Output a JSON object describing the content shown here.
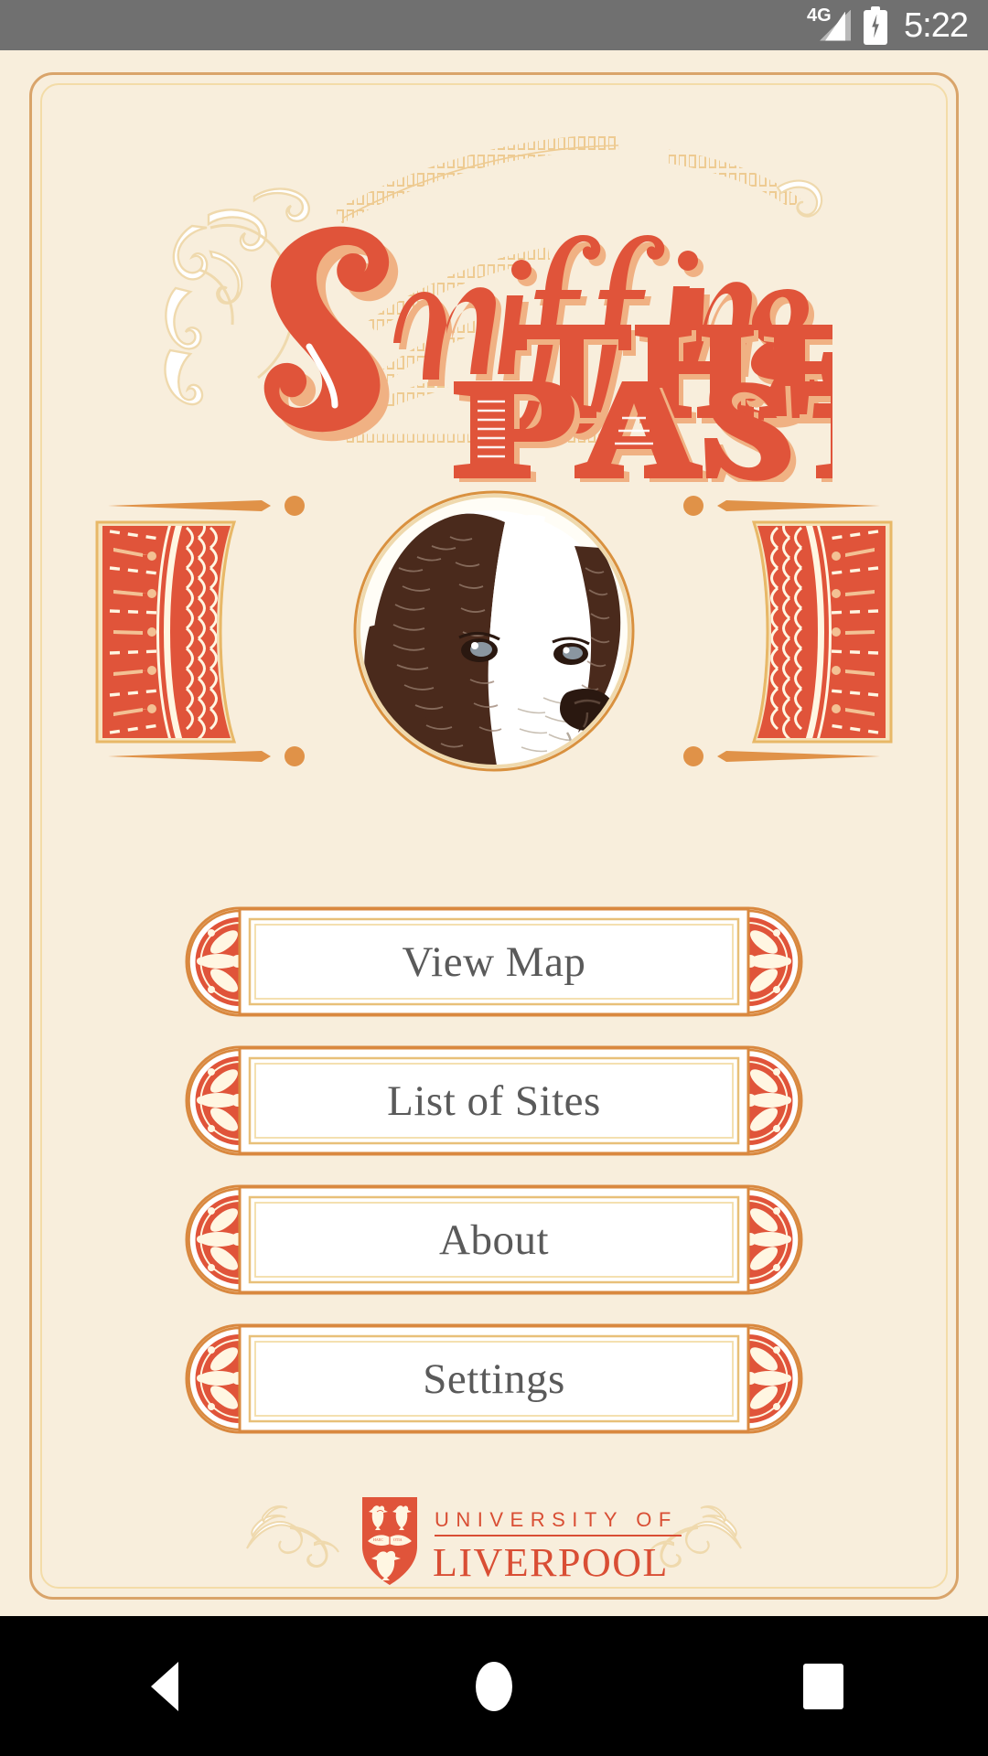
{
  "status_bar": {
    "network_label": "4G",
    "network_icon": "signal-bars-icon",
    "battery_icon": "battery-charging-icon",
    "time": "5:22"
  },
  "app": {
    "title_line1": "Sniffing",
    "title_line2": "THE",
    "title_line3": "PAST",
    "hero_icon": "dog-portrait-illustration"
  },
  "menu": {
    "items": [
      {
        "label": "View Map",
        "name": "view-map"
      },
      {
        "label": "List of Sites",
        "name": "list-of-sites"
      },
      {
        "label": "About",
        "name": "about"
      },
      {
        "label": "Settings",
        "name": "settings"
      }
    ]
  },
  "footer": {
    "university_line1": "UNIVERSITY OF",
    "university_line2": "LIVERPOOL",
    "crest_icon": "liverpool-shield-crest-icon"
  },
  "nav_bar": {
    "back_icon": "back-triangle-icon",
    "home_icon": "home-circle-icon",
    "recents_icon": "recents-square-icon"
  },
  "colors": {
    "background": "#F8EEDC",
    "accent_red": "#E0543A",
    "accent_peach": "#F3C194",
    "accent_gold": "#E8C079",
    "border_tan": "#D9A46A",
    "text_gray": "#5A5A5A",
    "status_bar": "#707070",
    "nav_bar": "#000000",
    "dog_brown": "#4A2A1C"
  }
}
